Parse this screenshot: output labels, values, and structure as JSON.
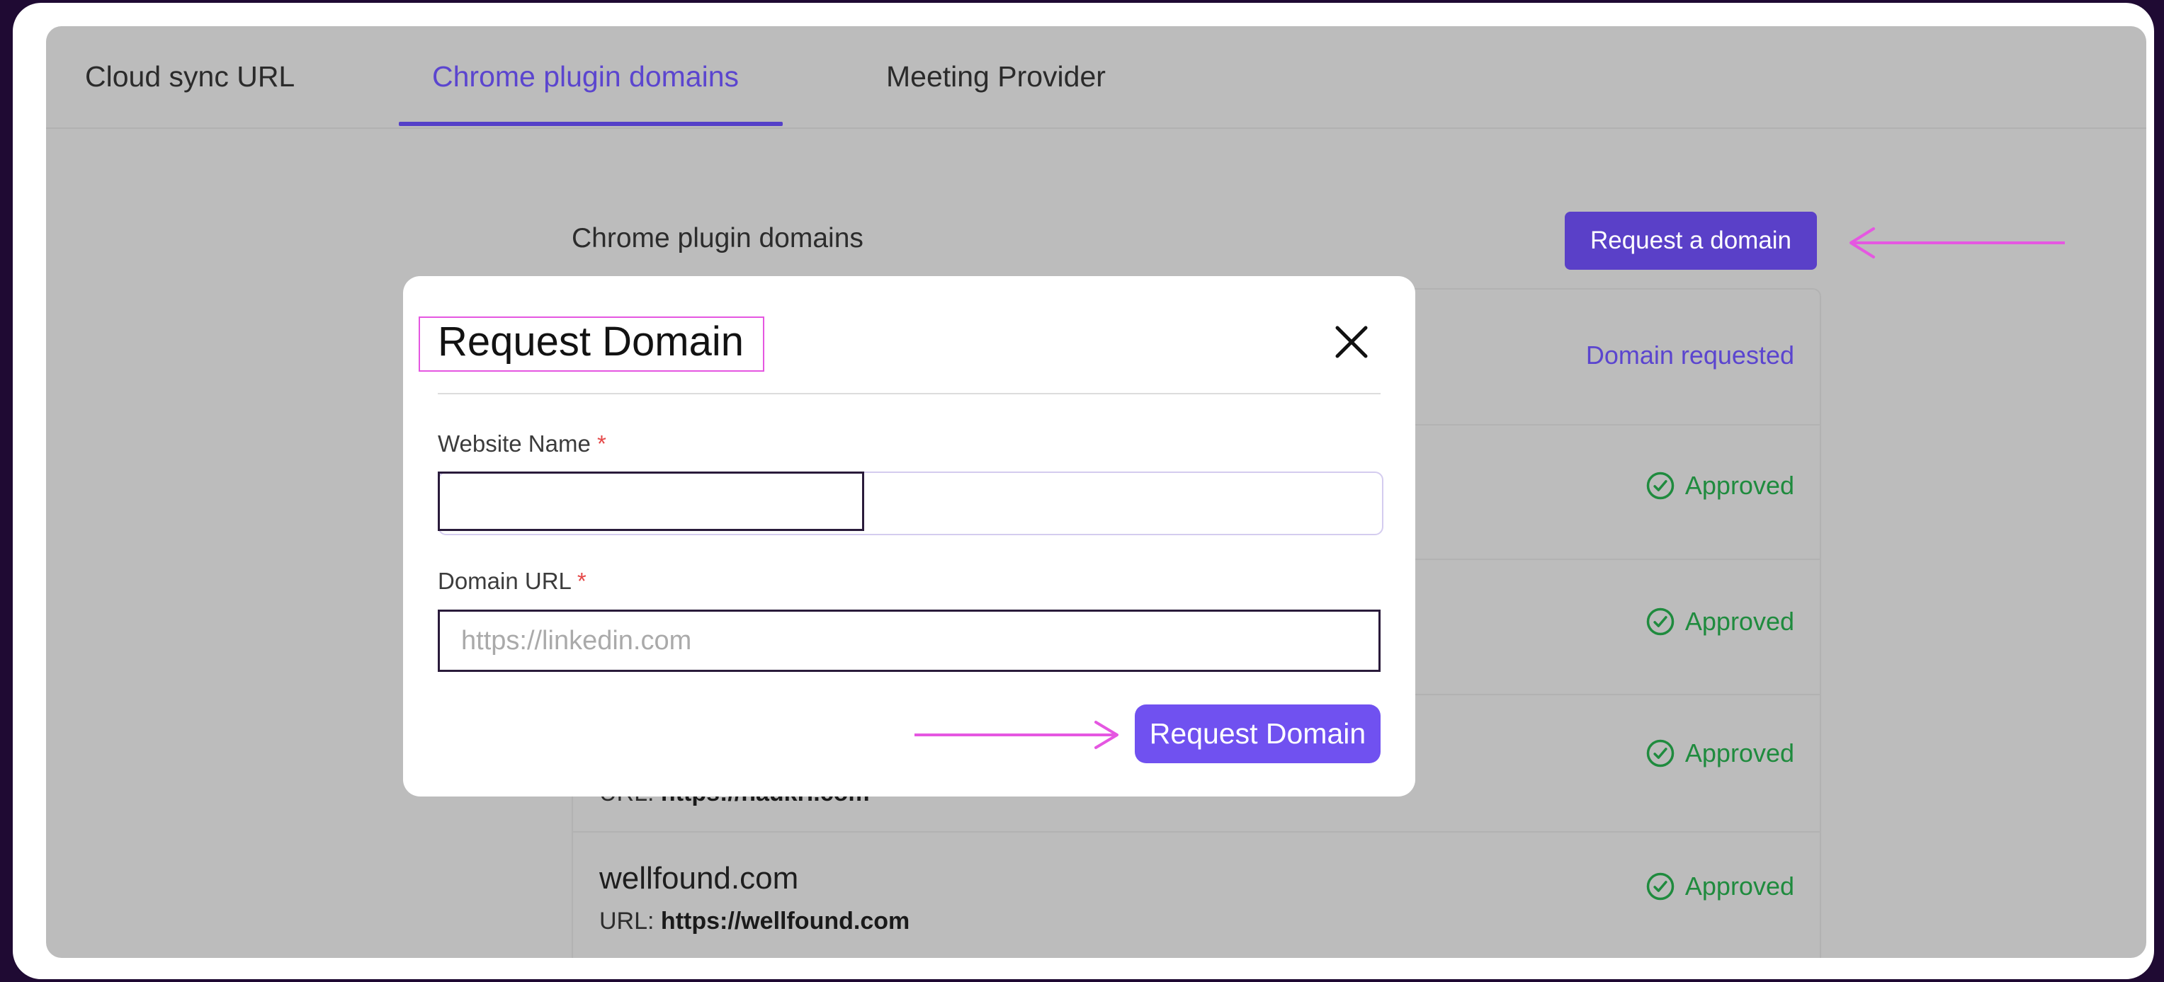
{
  "tabs": [
    {
      "label": "Cloud sync URL"
    },
    {
      "label": "Chrome plugin domains"
    },
    {
      "label": "Meeting Provider"
    }
  ],
  "section": {
    "title": "Chrome plugin domains",
    "request_button": "Request a domain"
  },
  "rows": [
    {
      "name": "",
      "url_label": "",
      "url": "",
      "status": "Domain requested"
    },
    {
      "name": "",
      "url_label": "",
      "url": "",
      "status": "Approved"
    },
    {
      "name": "",
      "url_label": "",
      "url": "",
      "status": "Approved"
    },
    {
      "name": "",
      "url_label": "URL: ",
      "url": "https://naukri.com",
      "status": "Approved"
    },
    {
      "name": "wellfound.com",
      "url_label": "URL: ",
      "url": "https://wellfound.com",
      "status": "Approved"
    }
  ],
  "modal": {
    "title": "Request Domain",
    "website_label": "Website Name",
    "required_mark": "*",
    "website_value": "",
    "domain_label": "Domain URL",
    "domain_placeholder": "https://linkedin.com",
    "submit_label": "Request Domain"
  },
  "colors": {
    "accent": "#5a40c8",
    "approved": "#1f8b3e",
    "annotation": "#e557e1"
  },
  "icons": {
    "close": "close-icon",
    "approved": "check-circle-icon"
  }
}
